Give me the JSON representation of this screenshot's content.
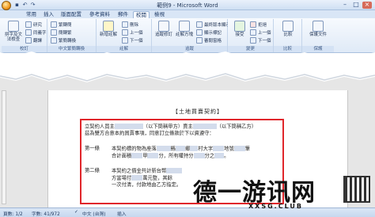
{
  "window": {
    "title": "範例9 - Microsoft Word"
  },
  "qat": {
    "save_icon": "save-icon",
    "undo_icon": "undo-icon",
    "redo_icon": "redo-icon"
  },
  "tabs": [
    "常用",
    "插入",
    "版面配置",
    "參考資料",
    "郵件",
    "校閱",
    "檢視"
  ],
  "ribbon": {
    "groups": [
      {
        "label": "校訂",
        "buttons": [
          "拼字及文法檢查",
          "研究",
          "同義字",
          "翻譯",
          "中文繁簡轉換"
        ]
      },
      {
        "label": "中文繁簡轉換",
        "buttons": [
          "繁轉簡",
          "簡轉繁",
          "繁簡轉換"
        ]
      },
      {
        "label": "註解",
        "buttons": [
          "新增註解",
          "刪除",
          "上一個",
          "下一個"
        ]
      },
      {
        "label": "追蹤",
        "buttons": [
          "追蹤修訂",
          "註解方塊",
          "最終版本顯示標記",
          "顯示標記",
          "審閱窗格"
        ]
      },
      {
        "label": "變更",
        "buttons": [
          "接受",
          "拒絕",
          "上一個",
          "下一個"
        ]
      },
      {
        "label": "比較",
        "buttons": [
          "比較"
        ]
      },
      {
        "label": "保護",
        "buttons": [
          "保護文件"
        ]
      }
    ]
  },
  "document": {
    "title": "【土地買賣契約】",
    "intro_1": "立契約人買主",
    "intro_1b": "（以下簡稱甲方）賣主",
    "intro_1c": "（以下簡稱乙方）",
    "intro_2": "茲為雙方合意本約買賣事項，同意訂立條款於下以資遵守：",
    "articles": [
      {
        "label": "第一條",
        "line1": "本契約標的物為座落",
        "line1b": "縣",
        "line1c": "鄉",
        "line1d": "村大字",
        "line1e": "地號",
        "line1f": "筆",
        "line2": "合計面積",
        "line2b": "甲",
        "line2c": "分，所有權持分",
        "line2d": "分之",
        "line2e": "。"
      },
      {
        "label": "第二條",
        "line1": "本契約之價金共計新台幣",
        "line2": "方當場付",
        "line2b": "萬元整，其餘",
        "line3": "一次付清，付款地由乙方指定。"
      }
    ]
  },
  "status": {
    "page": "頁數: 1/2",
    "words": "字數: 41/972",
    "lang": "中文 (台灣)",
    "mode": "插入"
  },
  "watermark": {
    "text": "德一游讯网",
    "sub": "XXSG.CLUB"
  }
}
